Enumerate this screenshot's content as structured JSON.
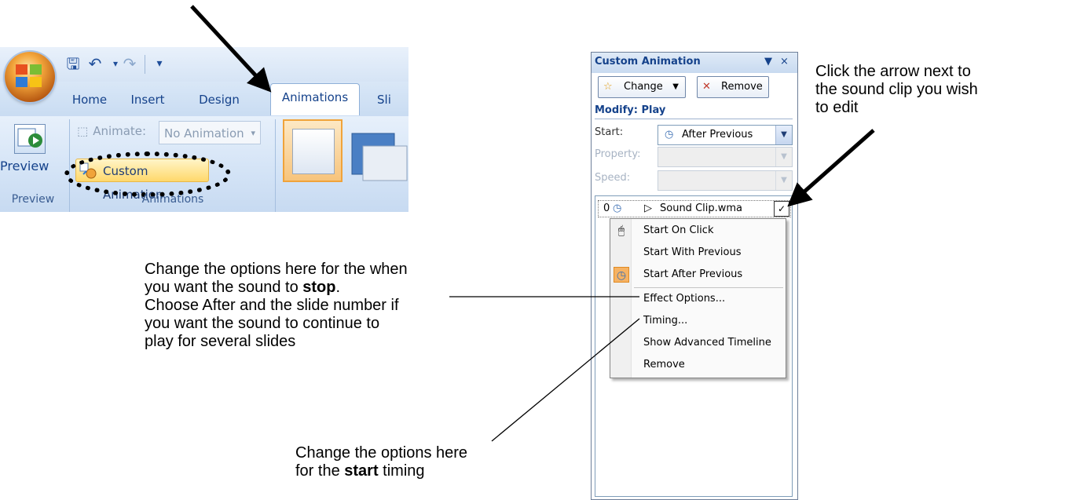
{
  "ribbon": {
    "tabs": [
      "Home",
      "Insert",
      "Design",
      "Animations",
      "Sli"
    ],
    "active_tab": "Animations",
    "preview_group": {
      "button_label": "Preview",
      "group_label": "Preview"
    },
    "animations_group": {
      "animate_label": "Animate:",
      "animate_value": "No Animation",
      "custom_animation_label": "Custom Animation",
      "group_label": "Animations"
    }
  },
  "pane": {
    "title": "Custom Animation",
    "close_glyph": "▼ ×",
    "change_label": "Change",
    "remove_label": "Remove",
    "modify_label": "Modify: Play",
    "start_label": "Start:",
    "start_value": "After Previous",
    "property_label": "Property:",
    "speed_label": "Speed:",
    "list_item": {
      "index": "0",
      "label": "Sound Clip.wma"
    }
  },
  "context_menu": {
    "items": [
      {
        "label": "Start On Click",
        "icon": "mouse-icon"
      },
      {
        "label": "Start With Previous",
        "icon": ""
      },
      {
        "label": "Start After Previous",
        "icon": "clock-icon",
        "checked": true
      },
      {
        "label": "Effect Options...",
        "icon": ""
      },
      {
        "label": "Timing...",
        "icon": ""
      },
      {
        "label": "Show Advanced Timeline",
        "icon": ""
      },
      {
        "label": "Remove",
        "icon": ""
      }
    ]
  },
  "annotations": {
    "right_note": [
      "Click the arrow next to",
      "the sound clip you wish",
      "to edit"
    ],
    "stop_note": {
      "line1": "Change the options here for the when",
      "line2_pre": "you want the sound to ",
      "line2_bold": "stop",
      "line2_post": ".",
      "line3": "Choose After and the slide number if",
      "line4": "you want the sound to continue to",
      "line5": "play for several slides"
    },
    "start_note": {
      "line1": "Change the options here",
      "line2_pre": "for the ",
      "line2_bold": "start",
      "line2_post": " timing"
    }
  },
  "colors": {
    "ribbon_text": "#15428b",
    "highlight": "#ffd86b",
    "checked_icon_bg": "#f6b263"
  }
}
